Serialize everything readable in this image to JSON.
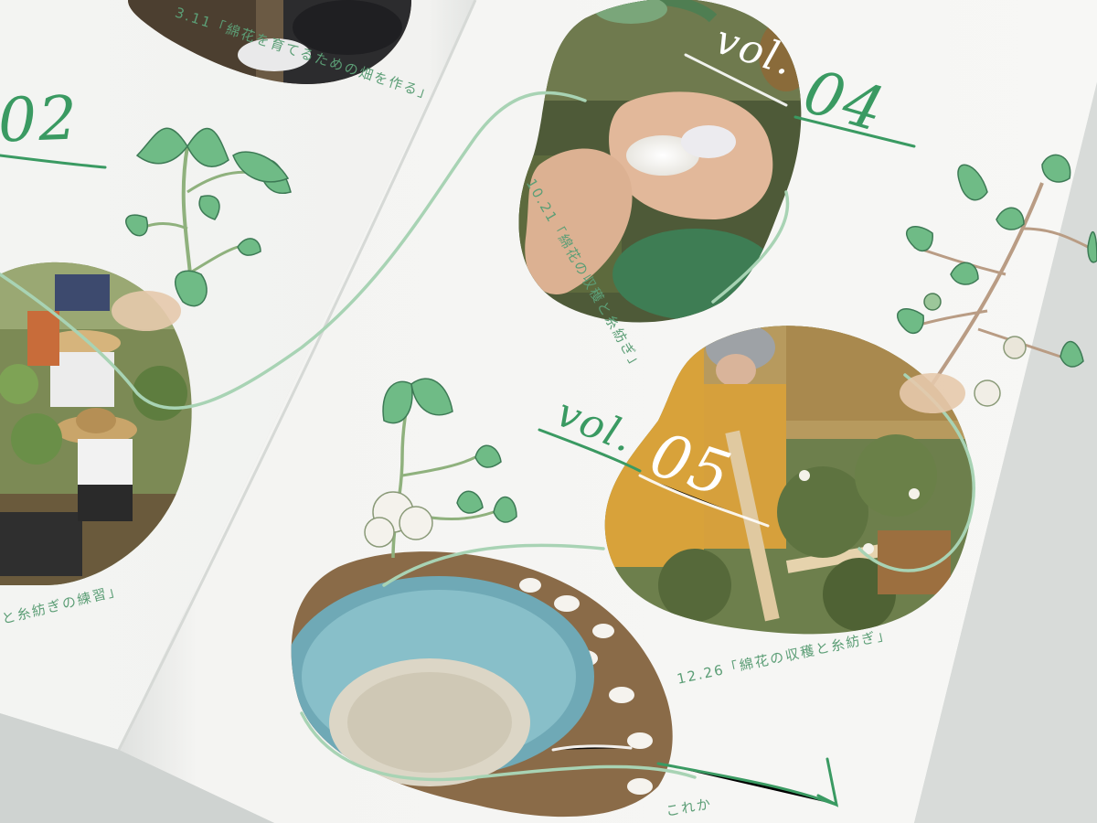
{
  "spread": {
    "vol_label": "vol.",
    "volumes": [
      {
        "number": "02",
        "caption": "3.11「綿花を育てるための畑を作る」"
      },
      {
        "number": "04",
        "caption": "10.21「綿花の収穫と糸紡ぎ」"
      },
      {
        "number": "05",
        "caption": "12.26「綿花の収穫と糸紡ぎ」"
      }
    ],
    "left_caption_partial": "と糸紡ぎの練習」",
    "bottom_caption_partial": "これか"
  },
  "colors": {
    "accent_green": "#3a9a62",
    "caption_green": "#5c9e76",
    "paper": "#f7f7f5",
    "leaf": "#5fae78"
  }
}
